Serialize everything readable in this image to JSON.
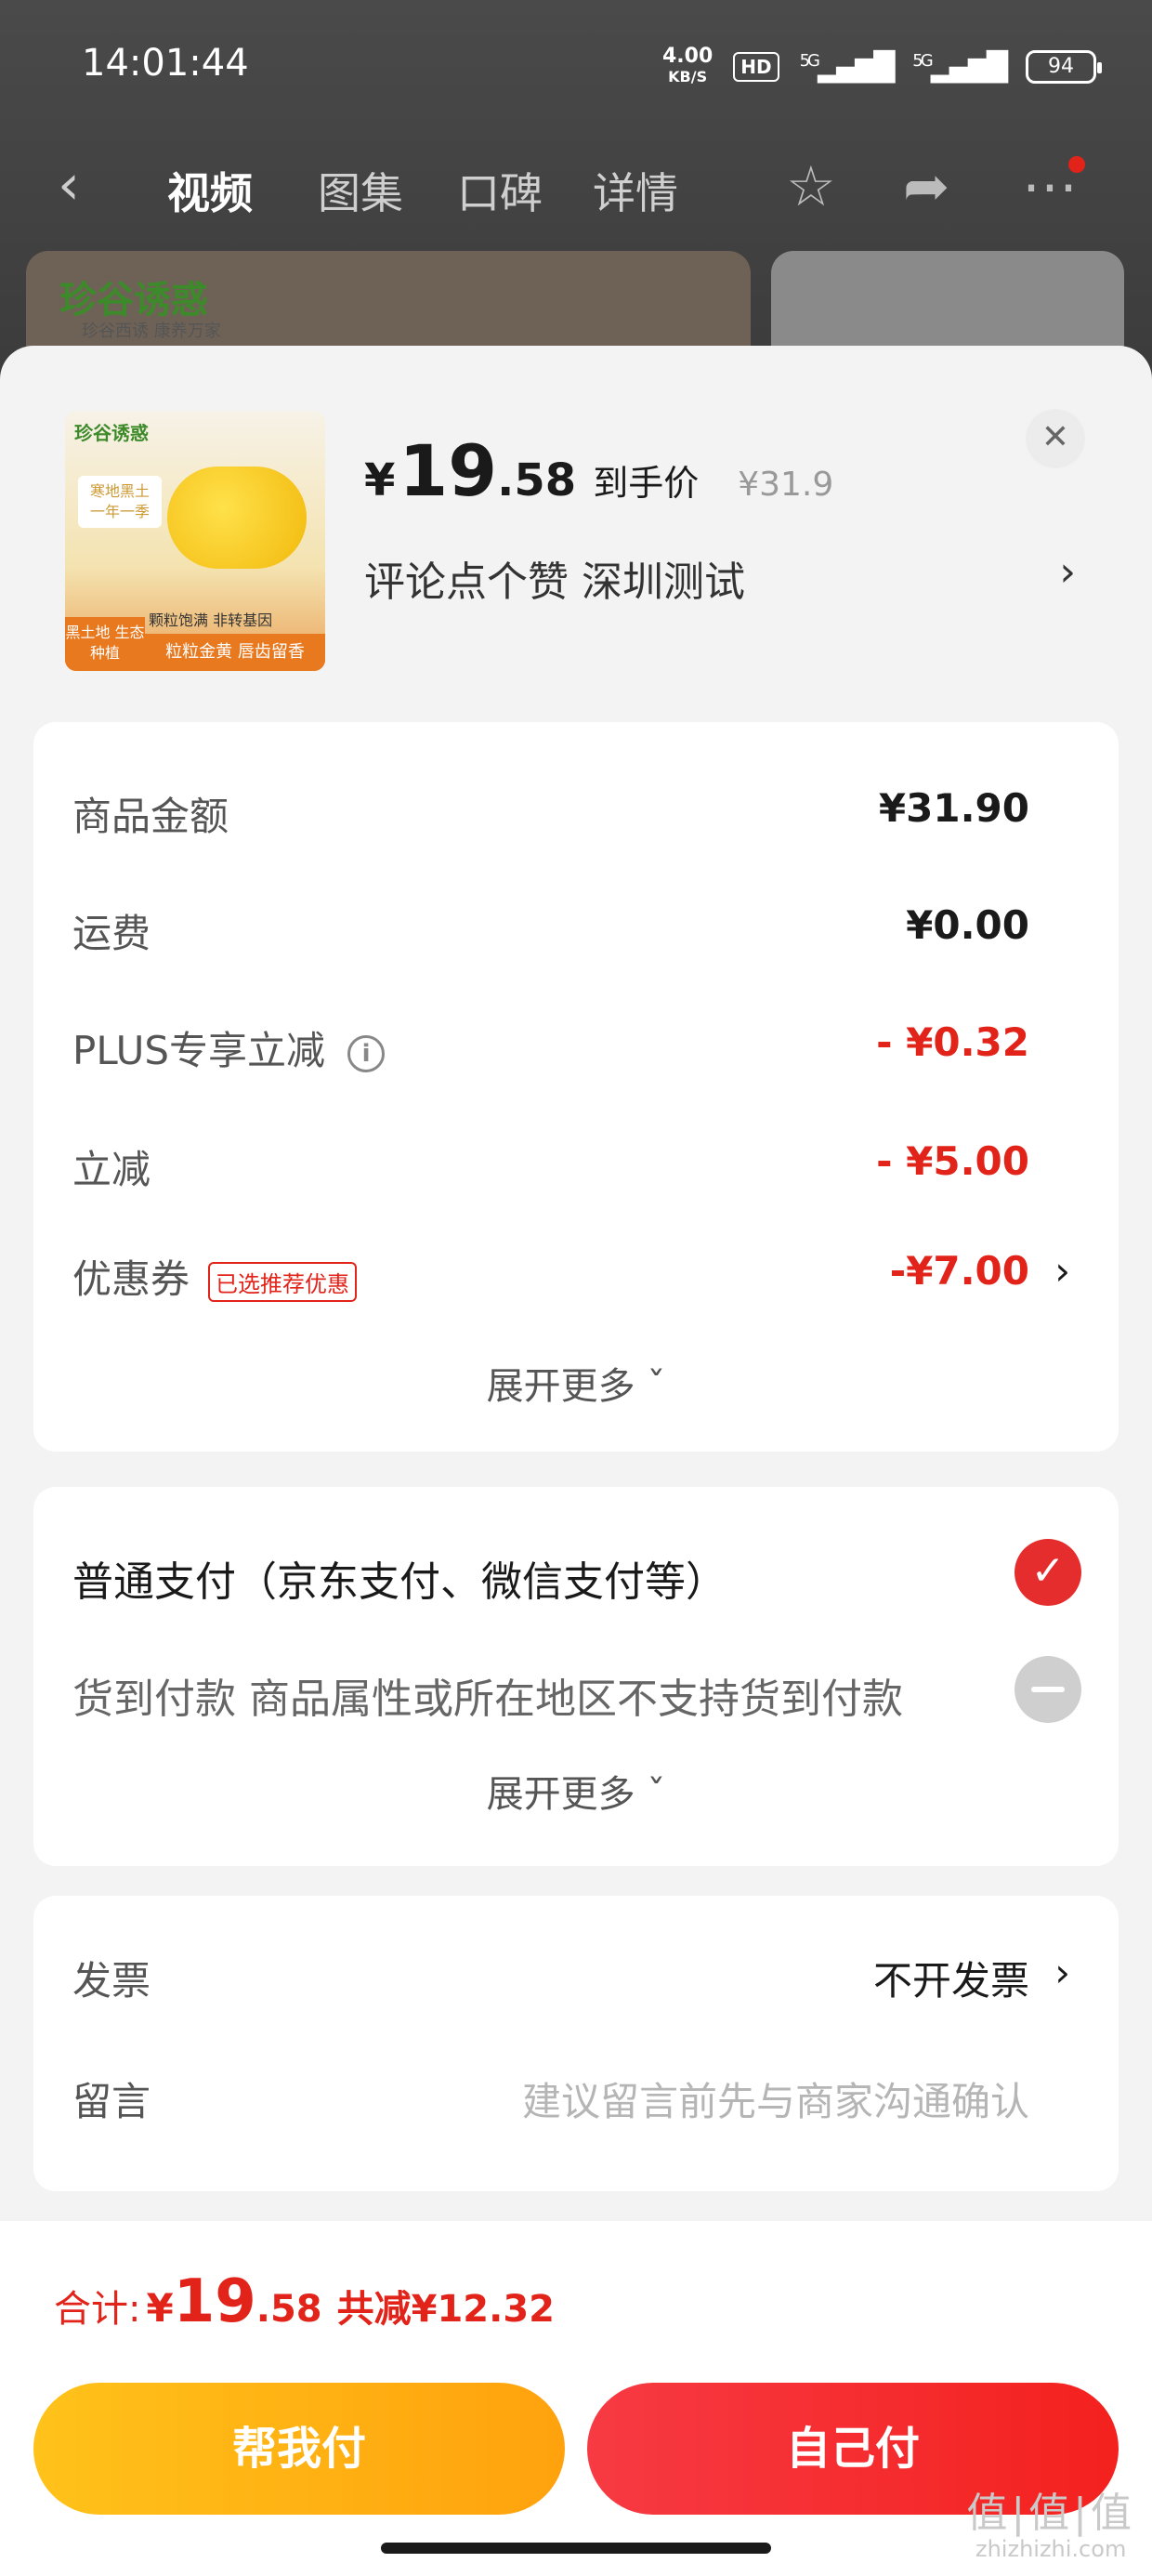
{
  "status_bar": {
    "time": "14:01:44",
    "net_speed_value": "4.00",
    "net_speed_unit": "KB/S",
    "hd_label": "HD",
    "signal1": "5G",
    "signal2": "5G",
    "battery": "94"
  },
  "nav": {
    "back_icon": "chevron-left-icon",
    "tabs": [
      "视频",
      "图集",
      "口碑",
      "详情"
    ],
    "active_tab": "视频",
    "favorite_icon": "star-icon",
    "share_icon": "share-icon",
    "more_icon": "more-icon"
  },
  "background_banner": {
    "logo": "珍谷诱惑",
    "slogan": "珍谷西诱 康养万家"
  },
  "product": {
    "image_brand": "珍谷诱惑",
    "image_tag_top": "寒地黑土 一年一季",
    "image_tag_left": "黑土地 生态种植",
    "image_tag_bottom": "粒粒金黄 唇齿留香",
    "image_tag_mid": "颗粒饱满 非转基因",
    "price_yen": "¥",
    "price_int": "19",
    "price_dec": ".58",
    "price_label": "到手价",
    "original_price": "¥31.9",
    "spec": "评论点个赞  深圳测试",
    "spec_arrow": "›",
    "close_label": "✕"
  },
  "summary": {
    "rows": [
      {
        "label": "商品金额",
        "value": "¥31.90"
      },
      {
        "label": "运费",
        "value": "¥0.00"
      },
      {
        "label": "PLUS专享立减",
        "value": "- ¥0.32"
      },
      {
        "label": "立减",
        "value": "- ¥5.00"
      },
      {
        "label": "优惠券",
        "value": "-¥7.00",
        "badge": "已选推荐优惠"
      }
    ],
    "info_icon": "i",
    "expand_more": "展开更多 ˇ"
  },
  "payment": {
    "options": [
      {
        "label": "普通支付（京东支付、微信支付等）",
        "selected": true
      },
      {
        "label": "货到付款 商品属性或所在地区不支持货到付款",
        "disabled": true
      }
    ],
    "check_mark": "✓",
    "expand_more": "展开更多 ˇ"
  },
  "extras": {
    "invoice_label": "发票",
    "invoice_value": "不开发票",
    "message_label": "留言",
    "message_placeholder": "建议留言前先与商家沟通确认"
  },
  "footer": {
    "total_label": "合计:",
    "total_yen": "¥",
    "total_int": "19",
    "total_dec": ".58",
    "total_saved": "共减¥12.32",
    "help_pay": "帮我付",
    "self_pay": "自己付"
  },
  "watermark": {
    "main": "值|值|值",
    "sub": "zhizhizhi.com"
  },
  "colors": {
    "accent_red": "#e2231a",
    "help_button": "#ffb413",
    "self_button": "#f4211e"
  }
}
